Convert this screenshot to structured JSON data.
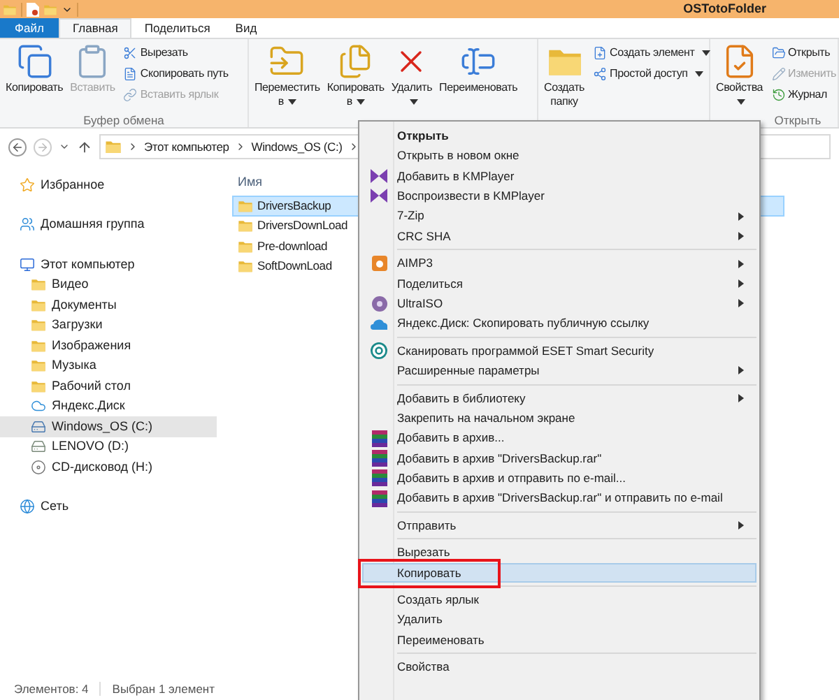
{
  "window": {
    "title": "OSTotoFolder"
  },
  "ribbon": {
    "file_tab": "Файл",
    "tabs": [
      {
        "label": "Главная",
        "selected": true
      },
      {
        "label": "Поделиться",
        "selected": false
      },
      {
        "label": "Вид",
        "selected": false
      }
    ],
    "groups": [
      {
        "label": "Буфер обмена",
        "large": [
          {
            "label": "Копировать",
            "disabled": false,
            "dropdown": false
          },
          {
            "label": "Вставить",
            "disabled": true,
            "dropdown": false
          }
        ],
        "small": [
          {
            "label": "Вырезать",
            "disabled": false,
            "dropdown": false
          },
          {
            "label": "Скопировать путь",
            "disabled": false,
            "dropdown": false
          },
          {
            "label": "Вставить ярлык",
            "disabled": true,
            "dropdown": false
          }
        ]
      },
      {
        "large": [
          {
            "label": "Переместить в",
            "disabled": false,
            "dropdown": true
          },
          {
            "label": "Копировать в",
            "disabled": false,
            "dropdown": true
          },
          {
            "label": "Удалить",
            "disabled": false,
            "dropdown": true
          },
          {
            "label": "Переименовать",
            "disabled": false,
            "dropdown": false
          }
        ]
      },
      {
        "large": [
          {
            "label": "Создать папку",
            "disabled": false,
            "dropdown": false
          }
        ],
        "small": [
          {
            "label": "Создать элемент",
            "disabled": false,
            "dropdown": true
          },
          {
            "label": "Простой доступ",
            "disabled": false,
            "dropdown": true
          }
        ]
      },
      {
        "label": "Открыть",
        "large": [
          {
            "label": "Свойства",
            "disabled": false,
            "dropdown": true
          }
        ],
        "small": [
          {
            "label": "Открыть",
            "disabled": false,
            "dropdown": false
          },
          {
            "label": "Изменить",
            "disabled": true,
            "dropdown": false
          },
          {
            "label": "Журнал",
            "disabled": false,
            "dropdown": false
          }
        ]
      }
    ]
  },
  "address": {
    "path": [
      "Этот компьютер",
      "Windows_OS (C:)"
    ]
  },
  "navigation": [
    {
      "label": "Избранное",
      "selected": false
    },
    {
      "label": "Домашняя группа",
      "selected": false
    },
    {
      "label": "Этот компьютер",
      "selected": false,
      "children": [
        {
          "label": "Видео",
          "selected": false
        },
        {
          "label": "Документы",
          "selected": false
        },
        {
          "label": "Загрузки",
          "selected": false
        },
        {
          "label": "Изображения",
          "selected": false
        },
        {
          "label": "Музыка",
          "selected": false
        },
        {
          "label": "Рабочий стол",
          "selected": false
        },
        {
          "label": "Яндекс.Диск",
          "selected": false
        },
        {
          "label": "Windows_OS (C:)",
          "selected": true
        },
        {
          "label": "LENOVO (D:)",
          "selected": false
        },
        {
          "label": "CD-дисковод (H:)",
          "selected": false
        }
      ]
    },
    {
      "label": "Сеть",
      "selected": false
    }
  ],
  "file_list": {
    "column": "Имя",
    "rows": [
      {
        "name": "DriversBackup",
        "selected": true
      },
      {
        "name": "DriversDownLoad",
        "selected": false
      },
      {
        "name": "Pre-download",
        "selected": false
      },
      {
        "name": "SoftDownLoad",
        "selected": false
      }
    ]
  },
  "context_menu": [
    {
      "kind": "item",
      "label": "Открыть",
      "default": true,
      "submenu": false,
      "selected": false,
      "outlined": false
    },
    {
      "kind": "item",
      "label": "Открыть в новом окне",
      "default": false,
      "submenu": false,
      "selected": false,
      "outlined": false
    },
    {
      "kind": "item",
      "label": "Добавить в KMPlayer",
      "default": false,
      "submenu": false,
      "selected": false,
      "outlined": false
    },
    {
      "kind": "item",
      "label": "Воспроизвести в KMPlayer",
      "default": false,
      "submenu": false,
      "selected": false,
      "outlined": false
    },
    {
      "kind": "item",
      "label": "7-Zip",
      "default": false,
      "submenu": true,
      "selected": false,
      "outlined": false
    },
    {
      "kind": "item",
      "label": "CRC SHA",
      "default": false,
      "submenu": true,
      "selected": false,
      "outlined": false
    },
    {
      "kind": "separator"
    },
    {
      "kind": "item",
      "label": "AIMP3",
      "default": false,
      "submenu": true,
      "selected": false,
      "outlined": false
    },
    {
      "kind": "item",
      "label": "Поделиться",
      "default": false,
      "submenu": true,
      "selected": false,
      "outlined": false
    },
    {
      "kind": "item",
      "label": "UltraISO",
      "default": false,
      "submenu": true,
      "selected": false,
      "outlined": false
    },
    {
      "kind": "item",
      "label": "Яндекс.Диск: Скопировать публичную ссылку",
      "default": false,
      "submenu": false,
      "selected": false,
      "outlined": false
    },
    {
      "kind": "separator"
    },
    {
      "kind": "item",
      "label": "Сканировать программой ESET Smart Security",
      "default": false,
      "submenu": false,
      "selected": false,
      "outlined": false
    },
    {
      "kind": "item",
      "label": "Расширенные параметры",
      "default": false,
      "submenu": true,
      "selected": false,
      "outlined": false
    },
    {
      "kind": "separator"
    },
    {
      "kind": "item",
      "label": "Добавить в библиотеку",
      "default": false,
      "submenu": true,
      "selected": false,
      "outlined": false
    },
    {
      "kind": "item",
      "label": "Закрепить на начальном экране",
      "default": false,
      "submenu": false,
      "selected": false,
      "outlined": false
    },
    {
      "kind": "item",
      "label": "Добавить в архив...",
      "default": false,
      "submenu": false,
      "selected": false,
      "outlined": false
    },
    {
      "kind": "item",
      "label": "Добавить в архив \"DriversBackup.rar\"",
      "default": false,
      "submenu": false,
      "selected": false,
      "outlined": false
    },
    {
      "kind": "item",
      "label": "Добавить в архив и отправить по e-mail...",
      "default": false,
      "submenu": false,
      "selected": false,
      "outlined": false
    },
    {
      "kind": "item",
      "label": "Добавить в архив \"DriversBackup.rar\" и отправить по e-mail",
      "default": false,
      "submenu": false,
      "selected": false,
      "outlined": false
    },
    {
      "kind": "separator"
    },
    {
      "kind": "item",
      "label": "Отправить",
      "default": false,
      "submenu": true,
      "selected": false,
      "outlined": false
    },
    {
      "kind": "separator"
    },
    {
      "kind": "item",
      "label": "Вырезать",
      "default": false,
      "submenu": false,
      "selected": false,
      "outlined": false
    },
    {
      "kind": "item",
      "label": "Копировать",
      "default": false,
      "submenu": false,
      "selected": true,
      "outlined": true
    },
    {
      "kind": "separator"
    },
    {
      "kind": "item",
      "label": "Создать ярлык",
      "default": false,
      "submenu": false,
      "selected": false,
      "outlined": false
    },
    {
      "kind": "item",
      "label": "Удалить",
      "default": false,
      "submenu": false,
      "selected": false,
      "outlined": false
    },
    {
      "kind": "item",
      "label": "Переименовать",
      "default": false,
      "submenu": false,
      "selected": false,
      "outlined": false
    },
    {
      "kind": "separator"
    },
    {
      "kind": "item",
      "label": "Свойства",
      "default": false,
      "submenu": false,
      "selected": false,
      "outlined": false
    }
  ],
  "status_bar": {
    "item_count": "Элементов: 4",
    "selection": "Выбран 1 элемент"
  }
}
